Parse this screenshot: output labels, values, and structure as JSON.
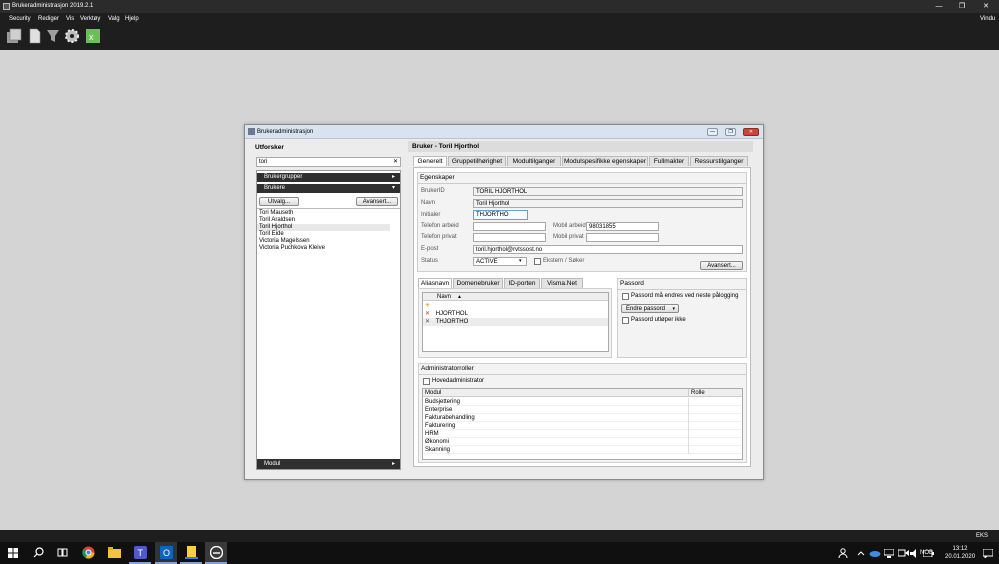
{
  "app": {
    "title": "Brukeradministrasjon 2019.2.1",
    "window_controls": {
      "minimize": "—",
      "restore": "❐",
      "close": "✕"
    },
    "menu": [
      "Security",
      "Rediger",
      "Vis",
      "Verktøy",
      "Valg",
      "Hjelp"
    ],
    "menu_right": "Vindu",
    "toolbar_icons": [
      "users-icon",
      "document-icon",
      "filter-icon",
      "gear-icon",
      "excel-icon"
    ]
  },
  "dialog": {
    "title": "Brukeradministrasjon",
    "explorer": {
      "header": "Utforsker",
      "search_value": "tori",
      "clear": "✕",
      "groups": [
        {
          "label": "Brukergrupper",
          "arrow": "▸"
        },
        {
          "label": "Brukere",
          "arrow": "▾"
        }
      ],
      "btn_select": "Utvalg...",
      "btn_advanced": "Avansert...",
      "users": [
        "Tori Mauseth",
        "Toril Araldsen",
        "Toril Hjorthol",
        "Toril Eide",
        "Victoria Magelssen",
        "Victoria Puchkova Kleive"
      ],
      "selected_index": 2,
      "module": {
        "label": "Modul",
        "arrow": "▸"
      }
    },
    "user": {
      "header": "Bruker - Toril Hjorthol",
      "tabs": [
        "Generelt",
        "Gruppetilhørighet",
        "Modultilganger",
        "Modulspesifikke egenskaper",
        "Fullmakter",
        "Ressurstilganger"
      ],
      "active_tab": 0,
      "props_title": "Egenskaper",
      "fields": {
        "brukerid": {
          "label": "BrukerID",
          "value": "TORIL HJORTHOL"
        },
        "navn": {
          "label": "Navn",
          "value": "Toril Hjorthol"
        },
        "initialer": {
          "label": "Initialer",
          "value": "THJORTHO"
        },
        "tlf_arbeid": {
          "label": "Telefon arbeid",
          "value": ""
        },
        "mobil_arbeid": {
          "label": "Mobil arbeid",
          "value": "98031855"
        },
        "tlf_privat": {
          "label": "Telefon privat",
          "value": ""
        },
        "mobil_privat": {
          "label": "Mobil privat",
          "value": ""
        },
        "epost": {
          "label": "E-post",
          "value": "toril.hjorthol@rvtssost.no"
        },
        "status": {
          "label": "Status",
          "value": "ACTIVE"
        },
        "ekstern": "Ekstern / Søker"
      },
      "advanced_btn": "Avansert...",
      "alias_tabs": [
        "Aliasnavn",
        "Domenebruker",
        "ID-porten",
        "Visma.Net"
      ],
      "alias_col": "Navn",
      "alias_sort": "▲",
      "alias_new": "✳",
      "alias_rows": [
        {
          "mark": "✕",
          "name": "HJORTHOL"
        },
        {
          "mark": "✕",
          "name": "THJORTHO"
        }
      ],
      "password": {
        "title": "Passord",
        "must_change": "Passord må endres ved neste pålogging",
        "change_btn": "Endre passord",
        "change_arrow": "▾",
        "never_expires": "Passord utløper ikke"
      },
      "admin": {
        "title": "Administratorroller",
        "main_admin": "Hovedadministrator",
        "col_modul": "Modul",
        "col_rolle": "Rolle",
        "modules": [
          "Budsjettering",
          "Enterprise",
          "Fakturabehandling",
          "Fakturering",
          "HRM",
          "Økonomi",
          "Skanning"
        ]
      }
    }
  },
  "status": {
    "right": "EKS"
  },
  "taskbar": {
    "icons": [
      "windows-icon",
      "search-icon",
      "task-view-icon",
      "chrome-icon",
      "file-explorer-icon",
      "teams-icon",
      "outlook-icon",
      "app-icon",
      "edge-icon"
    ],
    "tray": [
      "people-icon",
      "onedrive-icon",
      "network-icon",
      "video-icon",
      "volume-icon",
      "battery-icon"
    ],
    "language": "NOB",
    "time": "13:12",
    "date": "20.01.2020",
    "notification_icon": "notification-icon"
  }
}
